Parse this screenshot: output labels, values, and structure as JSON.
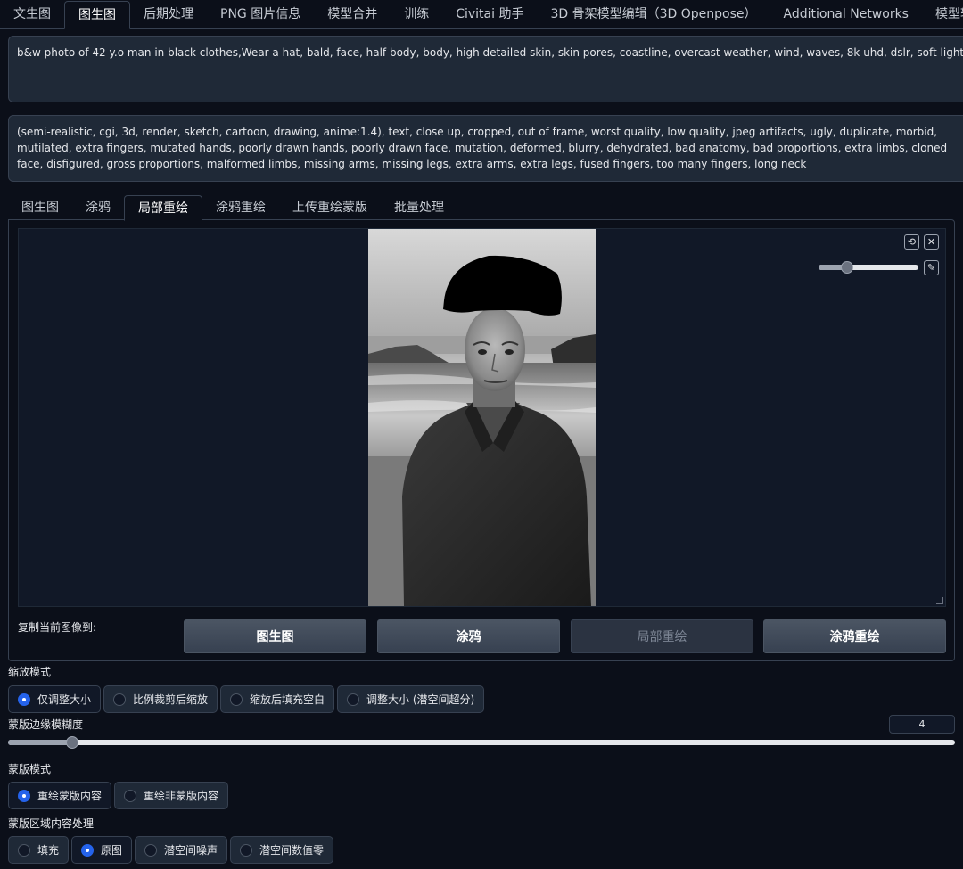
{
  "top_tabs": [
    "文生图",
    "图生图",
    "后期处理",
    "PNG 图片信息",
    "模型合并",
    "训练",
    "Civitai 助手",
    "3D 骨架模型编辑（3D Openpose）",
    "Additional Networks",
    "模型转换"
  ],
  "prompt": {
    "positive": "b&w photo of 42 y.o man in black clothes,Wear a hat, bald, face, half body, body, high detailed skin, skin pores, coastline, overcast weather, wind, waves, 8k uhd, dslr, soft lighting, high quality, film grain, Fujifilm",
    "negative": "(semi-realistic, cgi, 3d, render, sketch, cartoon, drawing, anime:1.4), text, close up, cropped, out of frame, worst quality, low quality, jpeg artifacts, ugly, duplicate, morbid, mutilated, extra fingers, mutated hands, poorly drawn hands, poorly drawn face, mutation, deformed, blurry, dehydrated, bad anatomy, bad proportions, extra limbs, cloned face, disfigured, gross proportions, malformed limbs, missing arms, missing legs, extra arms, extra legs, fused fingers, too many fingers, long neck"
  },
  "sub_tabs": [
    "图生图",
    "涂鸦",
    "局部重绘",
    "涂鸦重绘",
    "上传重绘蒙版",
    "批量处理"
  ],
  "canvas": {
    "undo_icon": "undo-icon",
    "clear_icon": "close-icon",
    "brush_icon": "brush-icon",
    "brush_size_fraction": 0.25
  },
  "copy_to": {
    "label": "复制当前图像到:",
    "buttons": [
      "图生图",
      "涂鸦",
      "局部重绘",
      "涂鸦重绘"
    ]
  },
  "resize_mode": {
    "label": "缩放模式",
    "options": [
      "仅调整大小",
      "比例裁剪后缩放",
      "缩放后填充空白",
      "调整大小 (潜空间超分)"
    ]
  },
  "mask_blur": {
    "label": "蒙版边缘模糊度",
    "value": "4",
    "fraction": 0.064
  },
  "mask_mode": {
    "label": "蒙版模式",
    "options": [
      "重绘蒙版内容",
      "重绘非蒙版内容"
    ]
  },
  "masked_content": {
    "label": "蒙版区域内容处理",
    "options": [
      "填充",
      "原图",
      "潜空间噪声",
      "潜空间数值零"
    ]
  },
  "colors": {
    "background": "#0b0f19",
    "panel": "#1f2937",
    "accent": "#2563eb"
  }
}
